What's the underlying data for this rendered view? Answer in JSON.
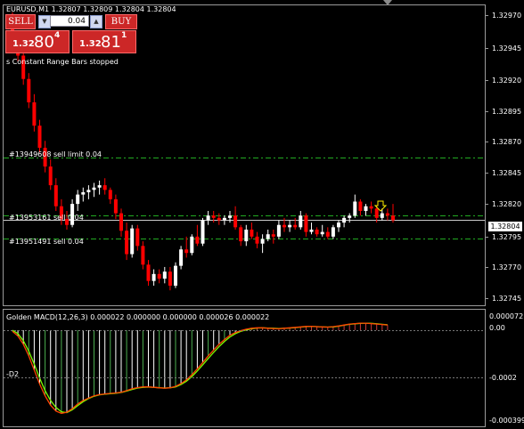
{
  "header": {
    "title": "EURUSD,M1  1.32807 1.32809 1.32804 1.32804"
  },
  "trade_panel": {
    "sell_label": "SELL",
    "buy_label": "BUY",
    "lot_value": "0.04",
    "sell_base": "1.32",
    "sell_big": "80",
    "sell_sup": "4",
    "buy_base": "1.32",
    "buy_big": "81",
    "buy_sup": "1"
  },
  "status_text": "s Constant Range Bars stopped",
  "orders": [
    {
      "label": "#13949608 sell limit 0.04",
      "price": 1.32858
    },
    {
      "label": "#13953161 sell 0.04",
      "price": 1.32808
    },
    {
      "label": "#13951491 sell 0.04",
      "price": 1.32788
    }
  ],
  "current_price_tag": "1.32804",
  "price_axis_labels": [
    "1.32970",
    "1.32945",
    "1.32920",
    "1.32895",
    "1.32870",
    "1.32845",
    "1.32820",
    "1.32795",
    "1.32770",
    "1.32745"
  ],
  "indicator": {
    "title": "Golden MACD(12,26,3) 0.000022 0.000000 0.000000 0.000026 0.000022",
    "level_label": "-D2",
    "axis_labels": [
      "0.000072",
      "0.00",
      "-0.0002",
      "-0.000399"
    ]
  },
  "colors": {
    "bull": "#ffffff",
    "bear": "#ff0000",
    "order_line": "#22aa22",
    "macd_line": "#ff4500",
    "signal_line": "#7cfc00",
    "hist_pos": "#cc3a3a",
    "hist_neg_green": "#4caf50",
    "hist_neg_white": "#ffffff",
    "arrow": "#ffee00"
  },
  "chart_data": {
    "type": "candlestick",
    "symbol": "EURUSD",
    "timeframe": "M1",
    "price_range": [
      1.32735,
      1.32985
    ],
    "candles": [
      [
        1.32978,
        1.32982,
        1.32955,
        1.3296
      ],
      [
        1.3296,
        1.32966,
        1.3294,
        1.32945
      ],
      [
        1.32945,
        1.3295,
        1.3292,
        1.32925
      ],
      [
        1.32925,
        1.3293,
        1.329,
        1.32905
      ],
      [
        1.32905,
        1.32912,
        1.3288,
        1.32885
      ],
      [
        1.32885,
        1.3289,
        1.32862,
        1.32866
      ],
      [
        1.32866,
        1.32872,
        1.32845,
        1.3285
      ],
      [
        1.3285,
        1.32856,
        1.3283,
        1.32834
      ],
      [
        1.32834,
        1.3284,
        1.32812,
        1.32816
      ],
      [
        1.32816,
        1.32822,
        1.328,
        1.32805
      ],
      [
        1.32805,
        1.32812,
        1.32796,
        1.328
      ],
      [
        1.328,
        1.32822,
        1.32798,
        1.32818
      ],
      [
        1.32818,
        1.3283,
        1.32812,
        1.32826
      ],
      [
        1.32826,
        1.32832,
        1.3282,
        1.32828
      ],
      [
        1.32828,
        1.32834,
        1.32822,
        1.3283
      ],
      [
        1.3283,
        1.32836,
        1.32824,
        1.32832
      ],
      [
        1.32832,
        1.32838,
        1.32826,
        1.32834
      ],
      [
        1.32834,
        1.3284,
        1.32826,
        1.3283
      ],
      [
        1.3283,
        1.32832,
        1.32818,
        1.32822
      ],
      [
        1.32822,
        1.32826,
        1.32805,
        1.3281
      ],
      [
        1.3281,
        1.32814,
        1.3279,
        1.32795
      ],
      [
        1.32795,
        1.32802,
        1.3277,
        1.32775
      ],
      [
        1.32775,
        1.328,
        1.32772,
        1.32797
      ],
      [
        1.32797,
        1.328,
        1.32778,
        1.32782
      ],
      [
        1.32782,
        1.32786,
        1.32762,
        1.32766
      ],
      [
        1.32766,
        1.3277,
        1.32748,
        1.32752
      ],
      [
        1.32752,
        1.32762,
        1.32748,
        1.32758
      ],
      [
        1.32758,
        1.32762,
        1.3275,
        1.32754
      ],
      [
        1.32754,
        1.32764,
        1.3275,
        1.3276
      ],
      [
        1.3276,
        1.32764,
        1.32744,
        1.32748
      ],
      [
        1.32748,
        1.32768,
        1.32746,
        1.32765
      ],
      [
        1.32765,
        1.32782,
        1.32762,
        1.32779
      ],
      [
        1.32779,
        1.3279,
        1.32772,
        1.32776
      ],
      [
        1.32776,
        1.32792,
        1.32774,
        1.3279
      ],
      [
        1.3279,
        1.328,
        1.32782,
        1.32784
      ],
      [
        1.32784,
        1.32806,
        1.32782,
        1.32804
      ],
      [
        1.32804,
        1.32812,
        1.328,
        1.32808
      ],
      [
        1.32808,
        1.32812,
        1.32802,
        1.32806
      ],
      [
        1.32806,
        1.3281,
        1.328,
        1.32804
      ],
      [
        1.32804,
        1.32808,
        1.328,
        1.32806
      ],
      [
        1.32806,
        1.32812,
        1.32802,
        1.32808
      ],
      [
        1.32808,
        1.32816,
        1.32796,
        1.32798
      ],
      [
        1.32798,
        1.328,
        1.32782,
        1.32786
      ],
      [
        1.32786,
        1.328,
        1.32782,
        1.32796
      ],
      [
        1.32796,
        1.32802,
        1.32788,
        1.3279
      ],
      [
        1.3279,
        1.32794,
        1.3278,
        1.32784
      ],
      [
        1.32784,
        1.32792,
        1.32776,
        1.32788
      ],
      [
        1.32788,
        1.32796,
        1.32786,
        1.32792
      ],
      [
        1.32792,
        1.32796,
        1.32784,
        1.3279
      ],
      [
        1.3279,
        1.32804,
        1.32788,
        1.328
      ],
      [
        1.328,
        1.32806,
        1.32794,
        1.32798
      ],
      [
        1.32798,
        1.32804,
        1.32794,
        1.328
      ],
      [
        1.328,
        1.32806,
        1.32796,
        1.32798
      ],
      [
        1.32798,
        1.32812,
        1.32796,
        1.32808
      ],
      [
        1.32808,
        1.3281,
        1.3279,
        1.32794
      ],
      [
        1.32794,
        1.32802,
        1.32792,
        1.32796
      ],
      [
        1.32796,
        1.32798,
        1.3279,
        1.32792
      ],
      [
        1.32792,
        1.328,
        1.3279,
        1.32794
      ],
      [
        1.32794,
        1.32798,
        1.32788,
        1.3279
      ],
      [
        1.3279,
        1.328,
        1.32788,
        1.32798
      ],
      [
        1.32798,
        1.32804,
        1.32794,
        1.32802
      ],
      [
        1.32802,
        1.32808,
        1.32798,
        1.32806
      ],
      [
        1.32806,
        1.3281,
        1.32802,
        1.32808
      ],
      [
        1.32808,
        1.32826,
        1.32806,
        1.3282
      ],
      [
        1.3282,
        1.32822,
        1.32808,
        1.32812
      ],
      [
        1.32812,
        1.32818,
        1.32808,
        1.32816
      ],
      [
        1.32816,
        1.3282,
        1.3281,
        1.32814
      ],
      [
        1.32814,
        1.32816,
        1.32802,
        1.32806
      ],
      [
        1.32806,
        1.32814,
        1.32804,
        1.3281
      ],
      [
        1.3281,
        1.32814,
        1.32804,
        1.32808
      ],
      [
        1.32808,
        1.32818,
        1.32802,
        1.32804
      ]
    ],
    "macd": [
      -5,
      -25,
      -60,
      -110,
      -170,
      -230,
      -280,
      -320,
      -345,
      -355,
      -350,
      -335,
      -315,
      -300,
      -290,
      -280,
      -275,
      -272,
      -270,
      -268,
      -265,
      -258,
      -250,
      -245,
      -242,
      -242,
      -244,
      -246,
      -248,
      -246,
      -240,
      -228,
      -212,
      -190,
      -165,
      -138,
      -110,
      -85,
      -60,
      -40,
      -22,
      -10,
      -2,
      4,
      8,
      10,
      10,
      8,
      7,
      6,
      8,
      10,
      12,
      14,
      16,
      16,
      15,
      14,
      13,
      15,
      18,
      22,
      26,
      28,
      30,
      30,
      28,
      26,
      24,
      22
    ],
    "signal": [
      0,
      -15,
      -45,
      -90,
      -145,
      -205,
      -258,
      -300,
      -330,
      -348,
      -352,
      -340,
      -322,
      -305,
      -292,
      -282,
      -276,
      -273,
      -271,
      -269,
      -266,
      -260,
      -253,
      -247,
      -244,
      -243,
      -244,
      -246,
      -247,
      -246,
      -242,
      -232,
      -218,
      -198,
      -174,
      -148,
      -121,
      -95,
      -70,
      -48,
      -29,
      -15,
      -5,
      1,
      6,
      9,
      10,
      9,
      8,
      7,
      8,
      9,
      11,
      13,
      15,
      16,
      15,
      14,
      13,
      14,
      17,
      21,
      25,
      27,
      29,
      30,
      29,
      27,
      25,
      23
    ],
    "macd_range": [
      -0.000399,
      7.2e-05
    ],
    "level": -0.0002
  }
}
